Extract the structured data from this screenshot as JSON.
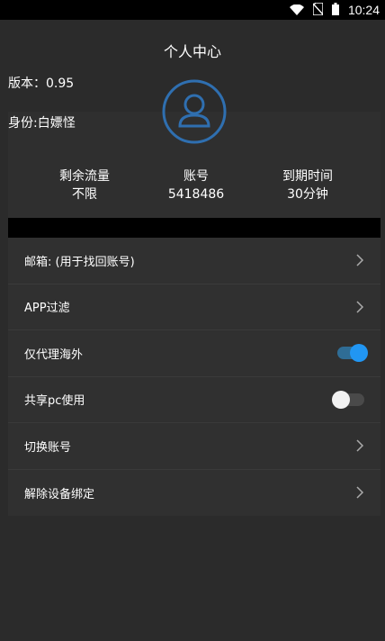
{
  "status_bar": {
    "time": "10:24"
  },
  "header": {
    "title": "个人中心"
  },
  "profile": {
    "version": "版本：0.95",
    "identity": "身份:白嫖怪"
  },
  "stats": [
    {
      "label": "剩余流量",
      "value": "不限"
    },
    {
      "label": "账号",
      "value": "5418486"
    },
    {
      "label": "到期时间",
      "value": "30分钟"
    }
  ],
  "menu": [
    {
      "label": "邮箱: (用于找回账号)",
      "control": "chevron"
    },
    {
      "label": "APP过滤",
      "control": "chevron"
    },
    {
      "label": "仅代理海外",
      "control": "toggle",
      "on": true
    },
    {
      "label": "共享pc使用",
      "control": "toggle",
      "on": false
    },
    {
      "label": "切换账号",
      "control": "chevron"
    },
    {
      "label": "解除设备绑定",
      "control": "chevron"
    }
  ],
  "colors": {
    "accent": "#2196f3",
    "avatar_ring": "#2f6fb0",
    "background": "#2b2b2b"
  }
}
